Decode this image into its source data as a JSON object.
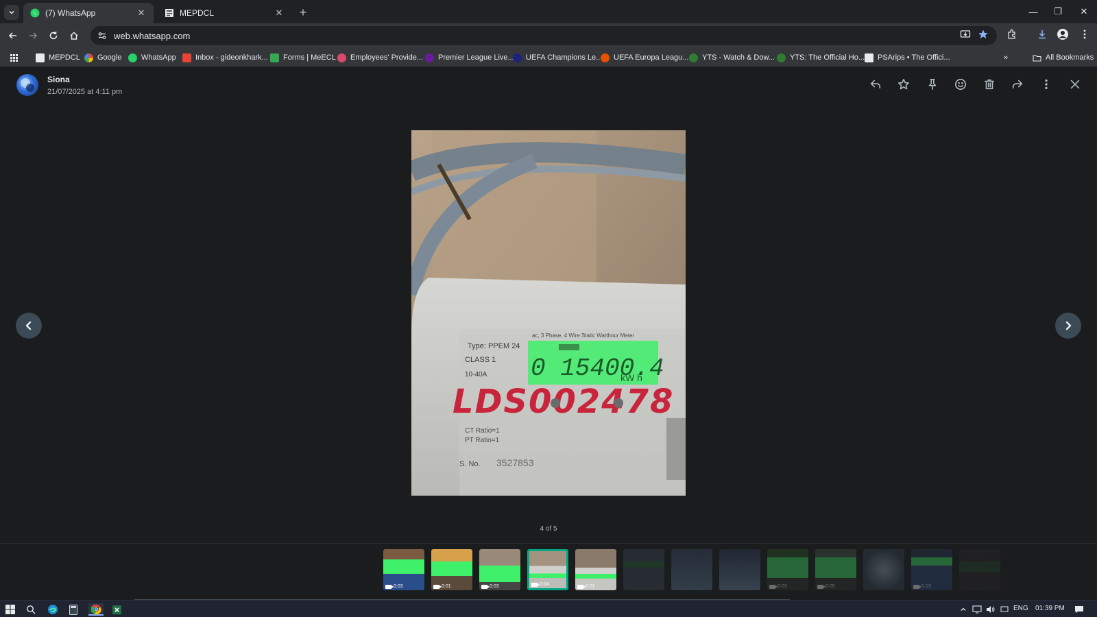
{
  "browser": {
    "tabs": [
      {
        "title": "(7) WhatsApp",
        "active": true
      },
      {
        "title": "MEPDCL",
        "active": false
      }
    ],
    "url": "web.whatsapp.com",
    "bookmarks": [
      {
        "label": "MEPDCL",
        "icon": "mepdcl-icon"
      },
      {
        "label": "Google",
        "icon": "google-icon"
      },
      {
        "label": "WhatsApp",
        "icon": "whatsapp-icon"
      },
      {
        "label": "Inbox - gideonkhark...",
        "icon": "gmail-icon"
      },
      {
        "label": "Forms | MeECL",
        "icon": "forms-icon"
      },
      {
        "label": "Employees' Provide...",
        "icon": "epfo-icon"
      },
      {
        "label": "Premier League Live...",
        "icon": "premier-league-icon"
      },
      {
        "label": "UEFA Champions Le...",
        "icon": "ucl-icon"
      },
      {
        "label": "UEFA Europa Leagu...",
        "icon": "uel-icon"
      },
      {
        "label": "YTS - Watch & Dow...",
        "icon": "yts-icon"
      },
      {
        "label": "YTS: The Official Ho...",
        "icon": "yts-icon"
      },
      {
        "label": "PSArips • The Offici...",
        "icon": "psarips-icon"
      }
    ],
    "all_bookmarks_label": "All Bookmarks"
  },
  "viewer": {
    "sender": "Siona",
    "timestamp": "21/07/2025 at 4:11 pm",
    "counter": "4 of 5",
    "photo": {
      "meter_type": "Type: PPEM 24",
      "meter_class": "CLASS 1",
      "meter_current": "10-40A",
      "meter_header": "ac, 3 Phase, 4 Wire Static Watthour Meter",
      "lcd_reading": "0 15400.4",
      "lcd_unit": "kW h",
      "handwritten_id": "LDS002478",
      "ct_ratio": "CT Ratio=1",
      "pt_ratio": "PT Ratio=1",
      "serial_label": "S. No.",
      "serial_value": "3527853"
    },
    "thumbnails": [
      {
        "duration": "0:03",
        "kind": "video"
      },
      {
        "duration": "0:01",
        "kind": "video"
      },
      {
        "duration": "0:03",
        "kind": "video"
      },
      {
        "duration": "0:04",
        "kind": "video",
        "selected": true
      },
      {
        "duration": "0:01",
        "kind": "video"
      },
      {
        "duration": "",
        "kind": "image"
      },
      {
        "duration": "",
        "kind": "image"
      },
      {
        "duration": "",
        "kind": "image"
      },
      {
        "duration": "0:03",
        "kind": "video"
      },
      {
        "duration": "0:05",
        "kind": "video"
      },
      {
        "duration": "",
        "kind": "image"
      },
      {
        "duration": "0:13",
        "kind": "video"
      },
      {
        "duration": "",
        "kind": "image"
      }
    ]
  },
  "taskbar": {
    "language": "ENG",
    "time": "01:39 PM"
  },
  "colors": {
    "accent": "#00a884",
    "background": "#1b1c1d",
    "lcd_green": "#3ef06a",
    "handwriting_red": "#c8243b"
  }
}
